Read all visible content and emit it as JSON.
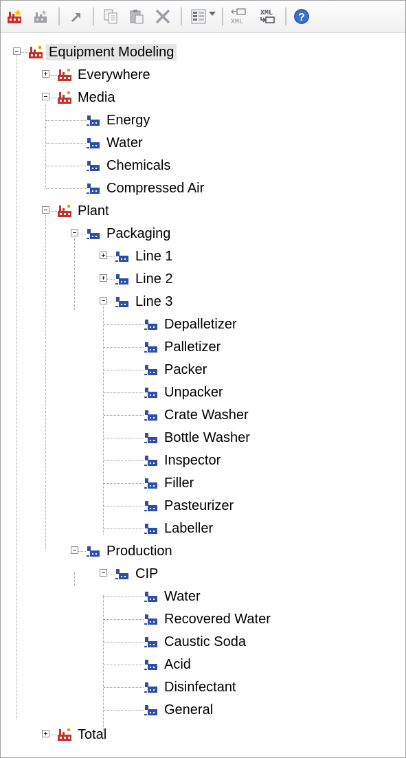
{
  "toolbar": {
    "buttons": [
      {
        "name": "new-factory-button",
        "icon": "new-factory-icon"
      },
      {
        "name": "new-equipment-button",
        "icon": "new-equipment-icon"
      },
      {
        "name": "link-button",
        "icon": "arrow-up-right-icon"
      },
      {
        "name": "copy-button",
        "icon": "copy-icon"
      },
      {
        "name": "paste-button",
        "icon": "paste-icon"
      },
      {
        "name": "delete-button",
        "icon": "delete-x-icon"
      },
      {
        "name": "properties-button",
        "icon": "properties-list-icon"
      },
      {
        "name": "xml-export-button",
        "icon": "xml-export-icon"
      },
      {
        "name": "xml-import-button",
        "icon": "xml-import-icon"
      },
      {
        "name": "help-button",
        "icon": "help-icon"
      }
    ]
  },
  "tree": {
    "root": "Equipment Modeling",
    "everywhere": "Everywhere",
    "media": "Media",
    "energy": "Energy",
    "water": "Water",
    "chemicals": "Chemicals",
    "compressed_air": "Compressed Air",
    "plant": "Plant",
    "packaging": "Packaging",
    "line1": "Line 1",
    "line2": "Line 2",
    "line3": "Line 3",
    "depalletizer": "Depalletizer",
    "palletizer": "Palletizer",
    "packer": "Packer",
    "unpacker": "Unpacker",
    "crate_washer": "Crate Washer",
    "bottle_washer": "Bottle Washer",
    "inspector": "Inspector",
    "filler": "Filler",
    "pasteurizer": "Pasteurizer",
    "labeller": "Labeller",
    "production": "Production",
    "cip": "CIP",
    "cip_water": "Water",
    "recovered_water": "Recovered Water",
    "caustic_soda": "Caustic Soda",
    "acid": "Acid",
    "disinfectant": "Disinfectant",
    "general": "General",
    "total": "Total"
  },
  "colors": {
    "factory_red": "#c8302a",
    "equipment_blue": "#2d4fa8",
    "selection": "#e5e5e5"
  }
}
